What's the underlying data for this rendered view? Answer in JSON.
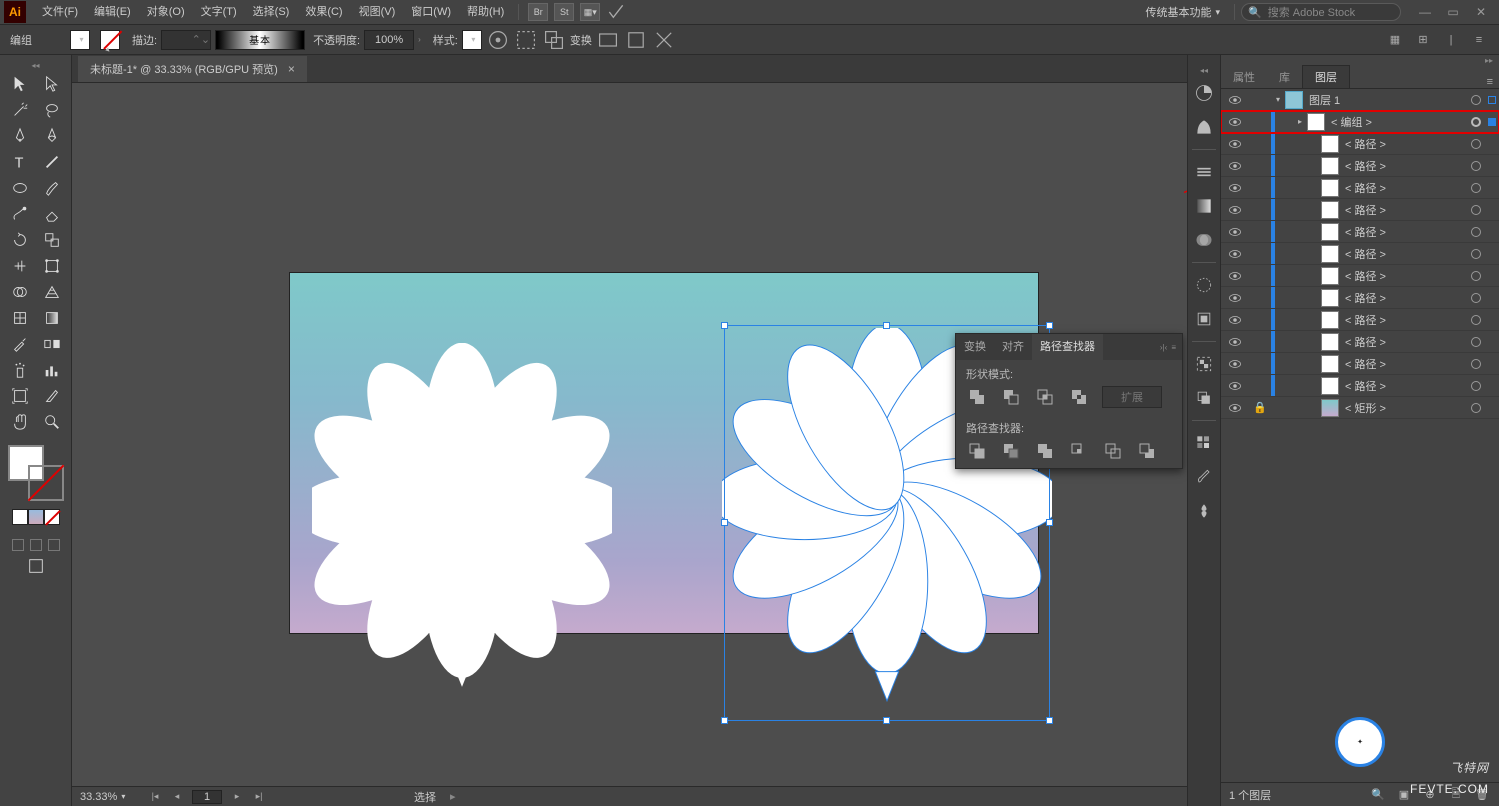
{
  "app_icon": "Ai",
  "menubar": {
    "items": [
      "文件(F)",
      "编辑(E)",
      "对象(O)",
      "文字(T)",
      "选择(S)",
      "效果(C)",
      "视图(V)",
      "窗口(W)",
      "帮助(H)"
    ],
    "toolbar_buttons": [
      "Br",
      "St"
    ],
    "workspace": "传统基本功能",
    "search_placeholder": "搜索 Adobe Stock"
  },
  "controlbar": {
    "context": "编组",
    "stroke_label": "描边:",
    "stroke_value": "",
    "profile_label": "基本",
    "opacity_label": "不透明度:",
    "opacity_value": "100%",
    "style_label": "样式:",
    "transform_label": "变换"
  },
  "document": {
    "tab_title": "未标题-1* @ 33.33% (RGB/GPU 预览)"
  },
  "pathfinder_panel": {
    "tabs": [
      "变换",
      "对齐",
      "路径查找器"
    ],
    "shape_mode_label": "形状模式:",
    "expand_label": "扩展",
    "pathfinder_label": "路径查找器:"
  },
  "statusbar": {
    "zoom": "33.33%",
    "page": "1",
    "tool": "选择"
  },
  "right_panel": {
    "tabs": [
      "属性",
      "库",
      "图层"
    ],
    "layer1_name": "图层 1",
    "group_name": "< 编组 >",
    "path_name": "< 路径 >",
    "rect_name": "< 矩形 >",
    "footer_count": "1 个图层"
  },
  "watermarks": {
    "w1": "飞特网",
    "w2": "FEVTE.COM"
  }
}
